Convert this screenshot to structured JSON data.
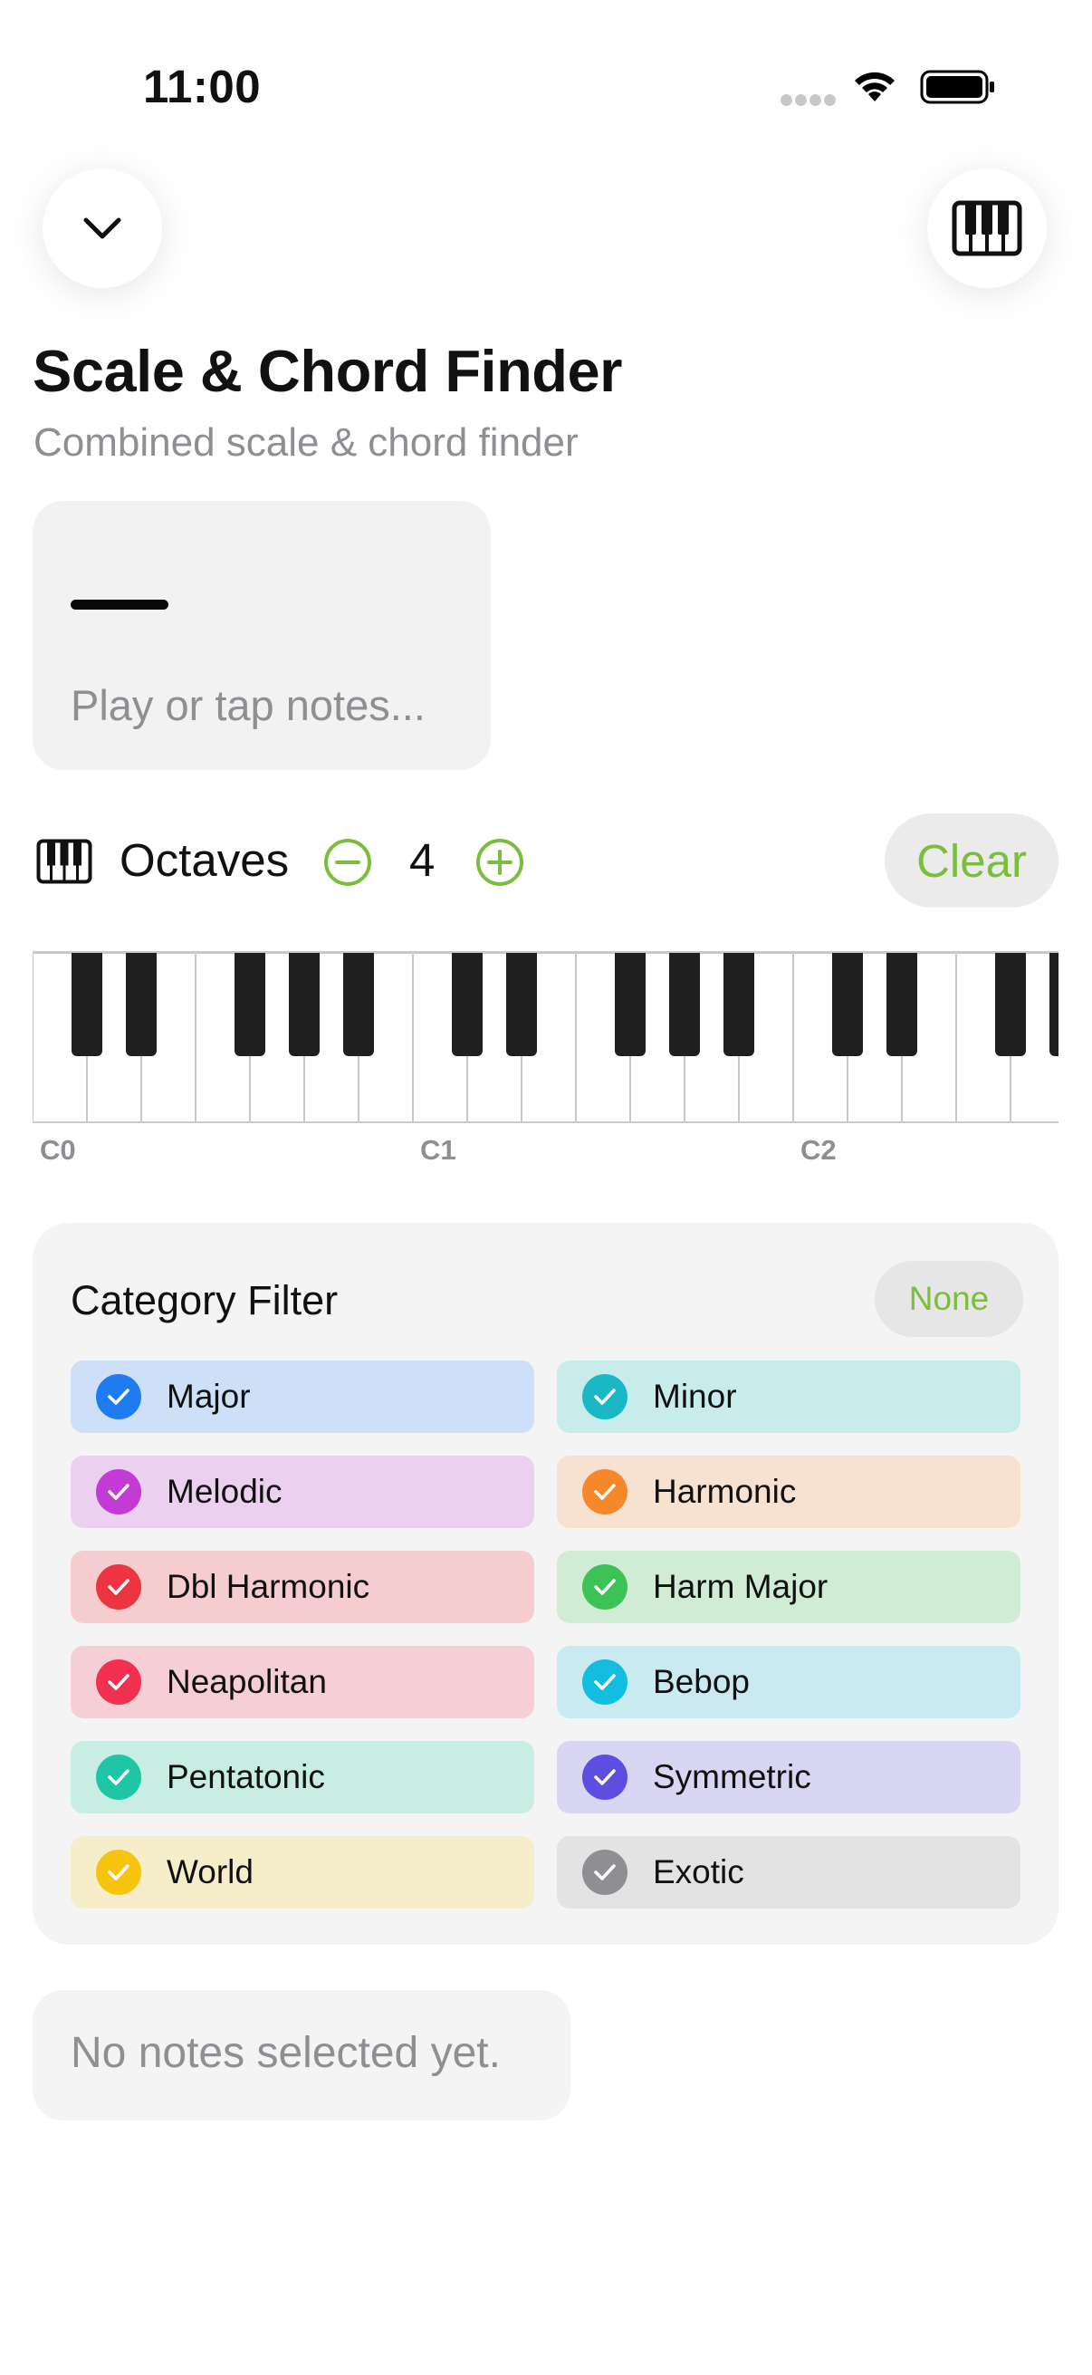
{
  "status_bar": {
    "time": "11:00"
  },
  "header": {
    "title": "Scale & Chord Finder",
    "subtitle": "Combined scale & chord finder"
  },
  "notes_display": {
    "placeholder": "Play or tap notes..."
  },
  "controls": {
    "octaves_label": "Octaves",
    "octaves_value": "4",
    "clear_label": "Clear"
  },
  "keyboard": {
    "octave_labels": [
      "C0",
      "C1",
      "C2"
    ]
  },
  "category_filter": {
    "title": "Category Filter",
    "none_label": "None",
    "accent_color": "#7cbd3d",
    "categories": [
      {
        "label": "Major",
        "color": "#1e7cf0",
        "bg": "#cde0f7"
      },
      {
        "label": "Minor",
        "color": "#1ab8c7",
        "bg": "#c8ecec"
      },
      {
        "label": "Melodic",
        "color": "#c23bd4",
        "bg": "#ecd0f0"
      },
      {
        "label": "Harmonic",
        "color": "#f5882a",
        "bg": "#f7e1d1"
      },
      {
        "label": "Dbl Harmonic",
        "color": "#ec3540",
        "bg": "#f6cdcf"
      },
      {
        "label": "Harm Major",
        "color": "#3cc255",
        "bg": "#d1ecd5"
      },
      {
        "label": "Neapolitan",
        "color": "#f0304e",
        "bg": "#f6ced6"
      },
      {
        "label": "Bebop",
        "color": "#12bde0",
        "bg": "#c9eaf1"
      },
      {
        "label": "Pentatonic",
        "color": "#1fc6a6",
        "bg": "#c8eee4"
      },
      {
        "label": "Symmetric",
        "color": "#5b4ee0",
        "bg": "#d9d6f3"
      },
      {
        "label": "World",
        "color": "#f6c40f",
        "bg": "#f6eecb"
      },
      {
        "label": "Exotic",
        "color": "#8e8e93",
        "bg": "#e3e3e3"
      }
    ]
  },
  "results": {
    "empty_text": "No notes selected yet."
  }
}
